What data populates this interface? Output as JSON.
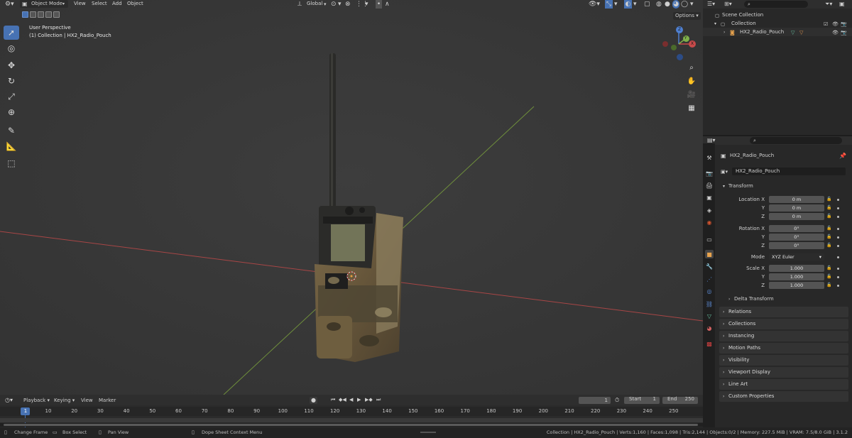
{
  "viewport": {
    "menu": {
      "mode": "Object Mode",
      "view": "View",
      "select": "Select",
      "add": "Add",
      "object": "Object"
    },
    "transform_orientation": "Global",
    "options_label": "Options",
    "overlay_title": "User Perspective",
    "overlay_subtitle": "(1) Collection | HX2_Radio_Pouch",
    "axis_labels": {
      "z": "Z",
      "y": "Y",
      "x": "X"
    },
    "tools": [
      "cursor-select",
      "cursor-3d",
      "move",
      "rotate",
      "scale",
      "transform",
      "annotate",
      "measure",
      "add-cube"
    ],
    "nav": [
      "zoom",
      "pan",
      "camera",
      "grid"
    ],
    "colors": {
      "viewport_bg": "#3a3a3a",
      "x_axis": "#b04c4c",
      "y_axis": "#7fa24a",
      "active_tool": "#4772b3"
    }
  },
  "outliner": {
    "scene_collection": "Scene Collection",
    "collection": "Collection",
    "object": "HX2_Radio_Pouch"
  },
  "properties": {
    "object_name": "HX2_Radio_Pouch",
    "data_name": "HX2_Radio_Pouch",
    "transform": {
      "section": "Transform",
      "location_label": "Location X",
      "location": [
        "0 m",
        "0 m",
        "0 m"
      ],
      "rotation_label": "Rotation X",
      "rotation": [
        "0°",
        "0°",
        "0°"
      ],
      "mode_label": "Mode",
      "mode_value": "XYZ Euler",
      "scale_label": "Scale X",
      "scale": [
        "1.000",
        "1.000",
        "1.000"
      ],
      "y": "Y",
      "z": "Z",
      "delta": "Delta Transform"
    },
    "panels": [
      "Relations",
      "Collections",
      "Instancing",
      "Motion Paths",
      "Visibility",
      "Viewport Display",
      "Line Art",
      "Custom Properties"
    ]
  },
  "timeline": {
    "menu": {
      "playback": "Playback",
      "keying": "Keying",
      "view": "View",
      "marker": "Marker"
    },
    "current_frame": "1",
    "start_label": "Start",
    "start": "1",
    "end_label": "End",
    "end": "250",
    "ticks": [
      "1",
      "10",
      "20",
      "30",
      "40",
      "50",
      "60",
      "70",
      "80",
      "90",
      "100",
      "110",
      "120",
      "130",
      "140",
      "150",
      "160",
      "170",
      "180",
      "190",
      "200",
      "210",
      "220",
      "230",
      "240",
      "250"
    ]
  },
  "statusbar": {
    "change_frame": "Change Frame",
    "box_select": "Box Select",
    "pan_view": "Pan View",
    "context_menu": "Dope Sheet Context Menu",
    "stats": "Collection | HX2_Radio_Pouch | Verts:1,160 | Faces:1,098 | Tris:2,144 | Objects:0/2 | Memory: 227.5 MiB | VRAM: 7.5/8.0 GiB | 3.1.2"
  }
}
